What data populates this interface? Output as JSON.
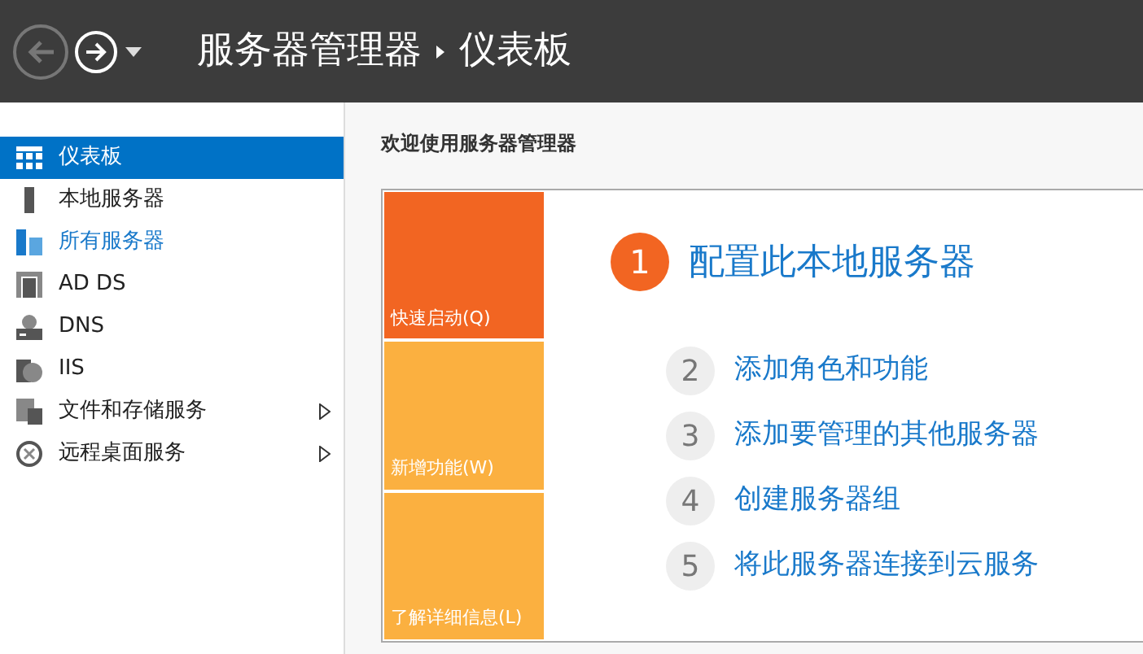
{
  "header": {
    "back_enabled": false,
    "forward_enabled": true,
    "breadcrumb": [
      "服务器管理器",
      "仪表板"
    ]
  },
  "sidebar": {
    "items": [
      {
        "label": "仪表板",
        "kind": "grid",
        "selected": true,
        "hover": false,
        "has_submenu": false
      },
      {
        "label": "本地服务器",
        "kind": "server",
        "selected": false,
        "hover": false,
        "has_submenu": false
      },
      {
        "label": "所有服务器",
        "kind": "servers",
        "selected": false,
        "hover": true,
        "has_submenu": false
      },
      {
        "label": "AD DS",
        "kind": "adds",
        "selected": false,
        "hover": false,
        "has_submenu": false
      },
      {
        "label": "DNS",
        "kind": "dns",
        "selected": false,
        "hover": false,
        "has_submenu": false
      },
      {
        "label": "IIS",
        "kind": "iis",
        "selected": false,
        "hover": false,
        "has_submenu": false
      },
      {
        "label": "文件和存储服务",
        "kind": "files",
        "selected": false,
        "hover": false,
        "has_submenu": true
      },
      {
        "label": "远程桌面服务",
        "kind": "remote",
        "selected": false,
        "hover": false,
        "has_submenu": true
      }
    ]
  },
  "welcome": {
    "title": "欢迎使用服务器管理器",
    "tiles": [
      {
        "label": "快速启动(Q)",
        "selected": true
      },
      {
        "label": "新增功能(W)",
        "selected": false
      },
      {
        "label": "了解详细信息(L)",
        "selected": false
      }
    ],
    "steps": [
      {
        "number": "1",
        "label": "配置此本地服务器",
        "primary": true
      },
      {
        "number": "2",
        "label": "添加角色和功能",
        "primary": false
      },
      {
        "number": "3",
        "label": "添加要管理的其他服务器",
        "primary": false
      },
      {
        "number": "4",
        "label": "创建服务器组",
        "primary": false
      },
      {
        "number": "5",
        "label": "将此服务器连接到云服务",
        "primary": false
      }
    ]
  }
}
